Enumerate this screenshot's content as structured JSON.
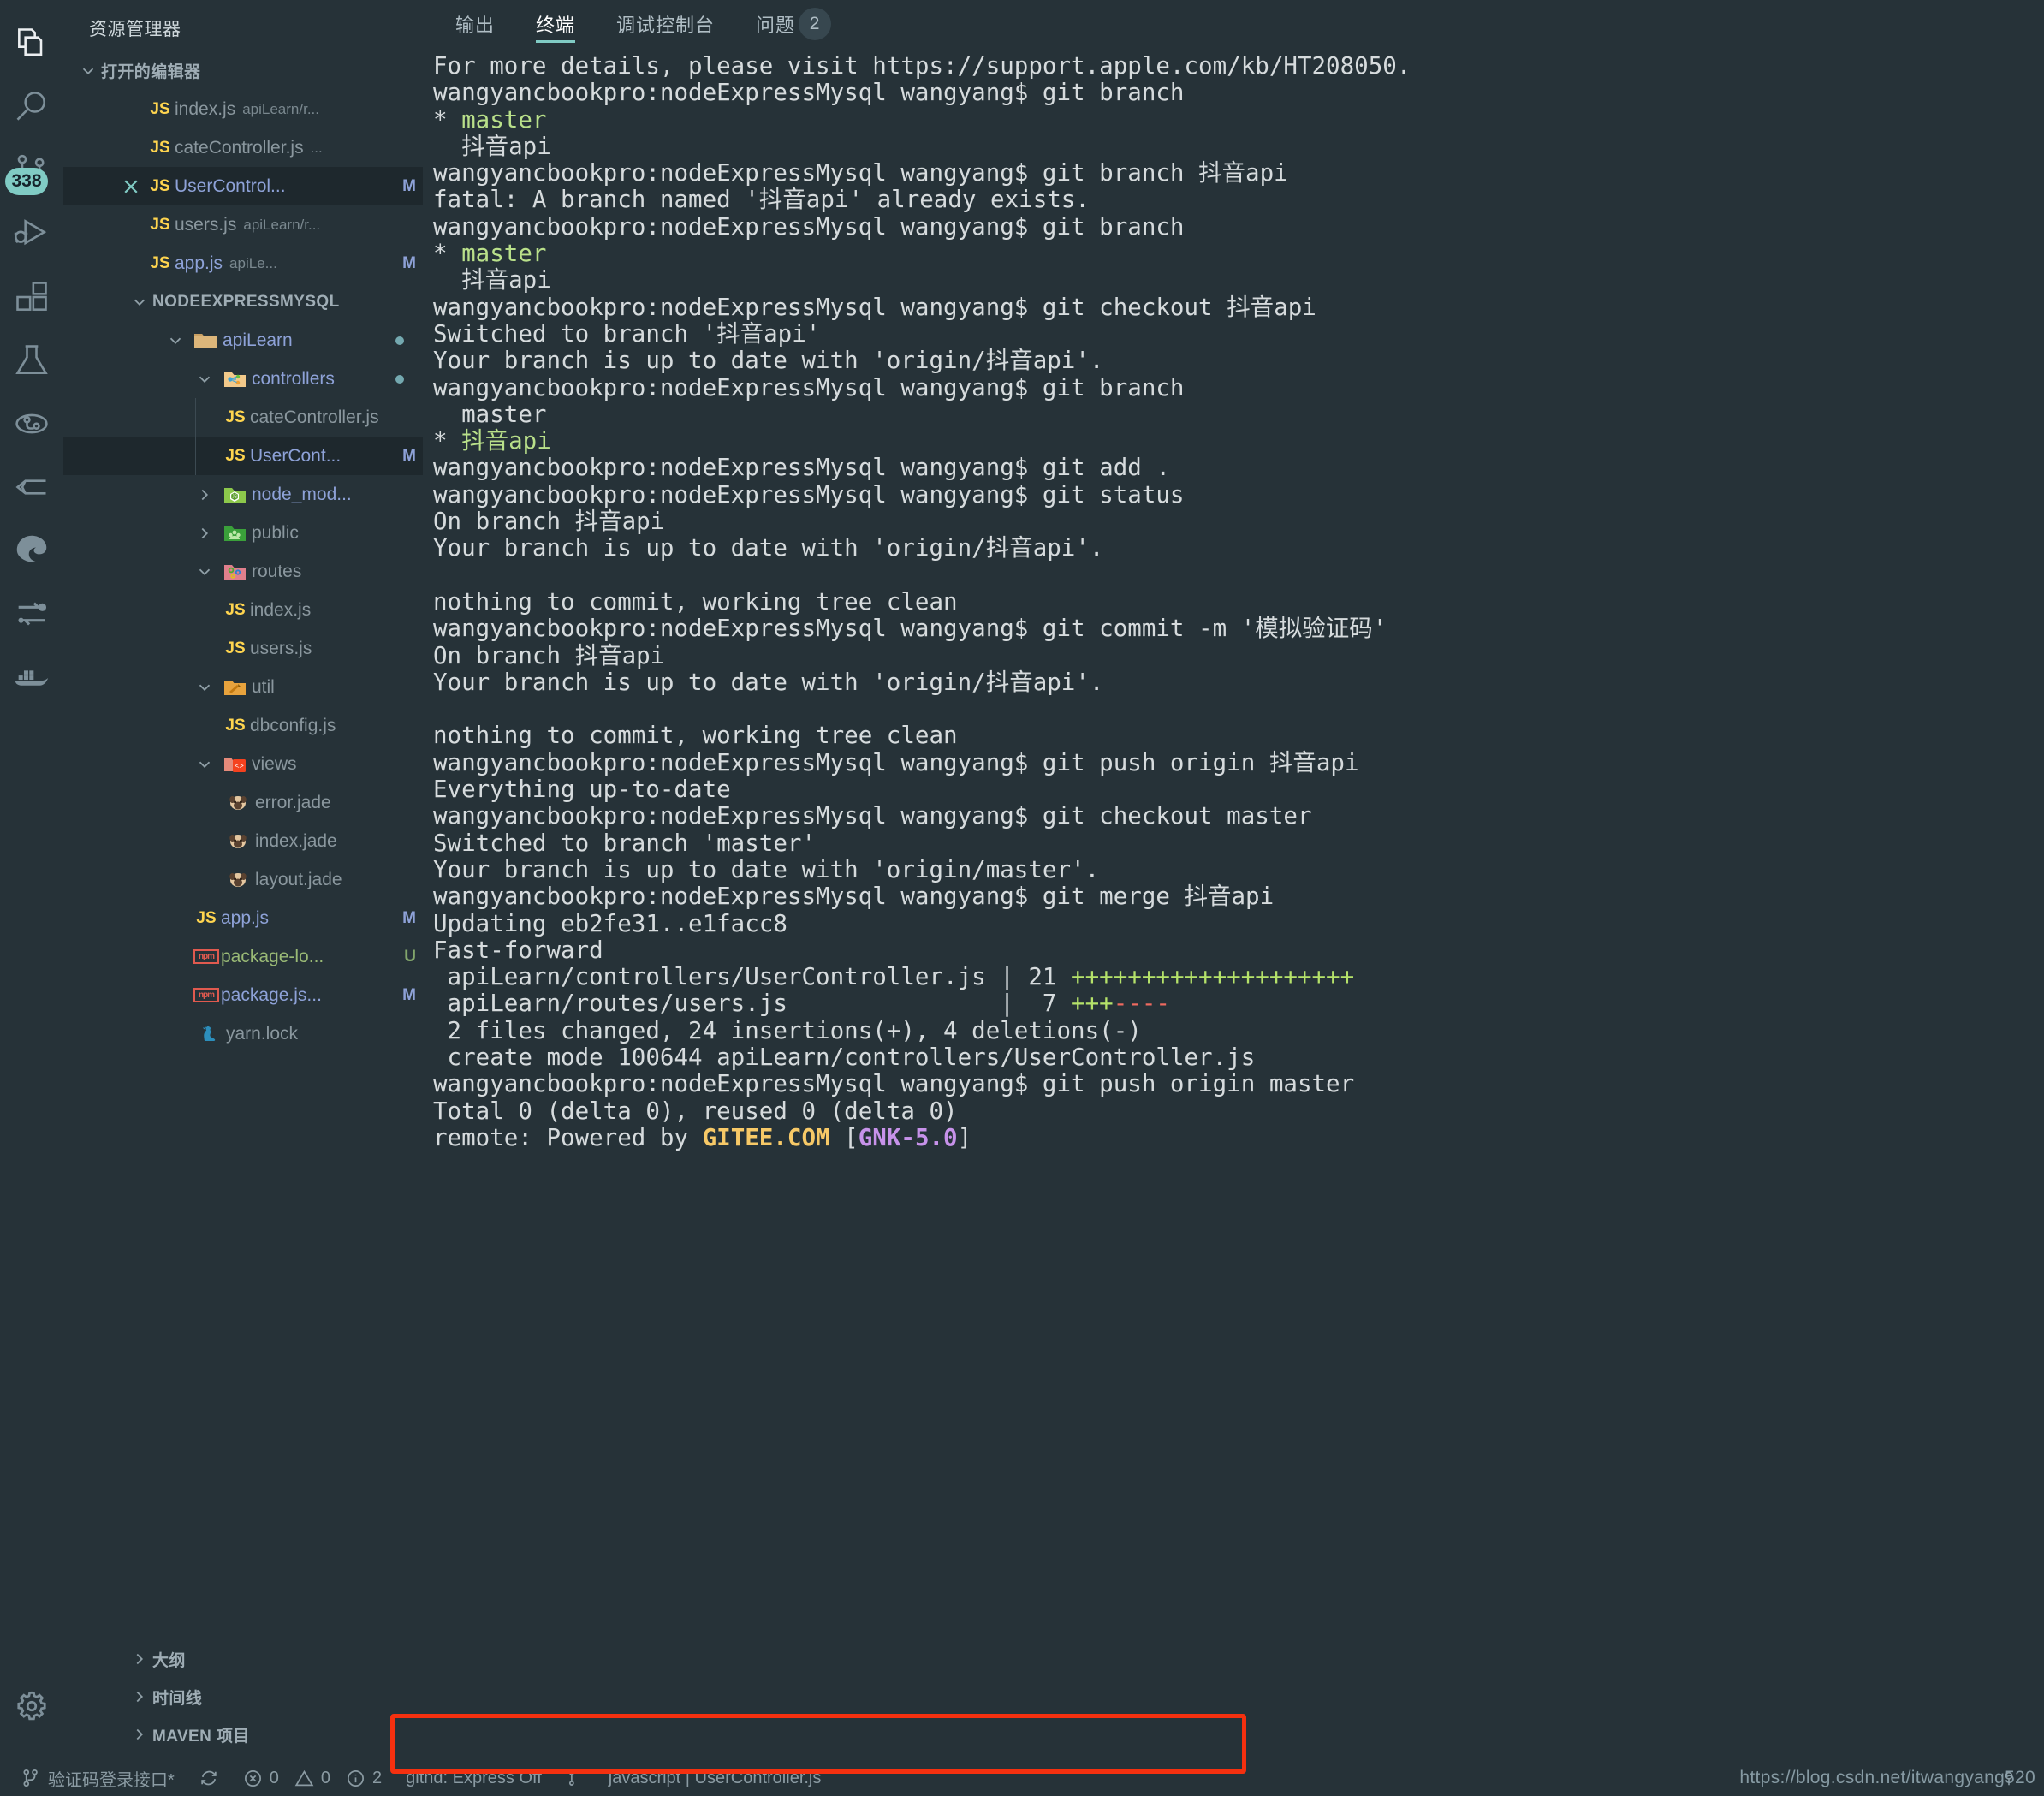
{
  "activity_bar": {
    "items": [
      {
        "name": "explorer-icon",
        "label": "资源管理器",
        "active": true
      },
      {
        "name": "search-icon",
        "label": "搜索",
        "active": false
      },
      {
        "name": "source-control-icon",
        "label": "源代码管理",
        "active": false,
        "badge": "338"
      },
      {
        "name": "run-debug-icon",
        "label": "运行和调试",
        "active": false
      },
      {
        "name": "extensions-icon",
        "label": "扩展",
        "active": false
      },
      {
        "name": "testing-flask-icon",
        "label": "测试",
        "active": false
      },
      {
        "name": "git-graph-icon",
        "label": "Git Graph",
        "active": false
      },
      {
        "name": "gitlens-icon",
        "label": "GitLens",
        "active": false
      },
      {
        "name": "browser-preview-icon",
        "label": "浏览器预览",
        "active": false
      },
      {
        "name": "diff-icon",
        "label": "Diff",
        "active": false
      },
      {
        "name": "docker-icon",
        "label": "Docker",
        "active": false
      }
    ],
    "settings_label": "管理"
  },
  "sidebar": {
    "title": "资源管理器",
    "open_editors": {
      "label": "打开的编辑器",
      "items": [
        {
          "icon": "js-file-icon",
          "name": "index.js",
          "desc": "apiLearn/r...",
          "badge": "",
          "selected": false,
          "close": false
        },
        {
          "icon": "js-file-icon",
          "name": "cateController.js",
          "desc": "...",
          "badge": "",
          "selected": false,
          "close": false
        },
        {
          "icon": "js-file-icon",
          "name": "UserControl...",
          "desc": "",
          "badge": "M",
          "selected": true,
          "close": true
        },
        {
          "icon": "js-file-icon",
          "name": "users.js",
          "desc": "apiLearn/r...",
          "badge": "",
          "selected": false,
          "close": false
        },
        {
          "icon": "js-file-icon",
          "name": "app.js",
          "desc": "apiLe...",
          "badge": "M",
          "selected": false,
          "close": false
        }
      ]
    },
    "project": {
      "label": "NODEEXPRESSMYSQL",
      "tree": [
        {
          "depth": 1,
          "kind": "folder",
          "icon": "folder-plain-icon",
          "name": "apiLearn",
          "expanded": true,
          "dot": true
        },
        {
          "depth": 2,
          "kind": "folder",
          "icon": "folder-controllers-icon",
          "name": "controllers",
          "expanded": true,
          "dot": true
        },
        {
          "depth": 3,
          "kind": "js",
          "icon": "js-file-icon",
          "name": "cateController.js"
        },
        {
          "depth": 3,
          "kind": "js",
          "icon": "js-file-icon",
          "name": "UserCont...",
          "badge": "M",
          "selected": true
        },
        {
          "depth": 2,
          "kind": "folder",
          "icon": "folder-node-icon",
          "name": "node_mod...",
          "expanded": false
        },
        {
          "depth": 2,
          "kind": "folder",
          "icon": "folder-public-icon",
          "name": "public",
          "expanded": false
        },
        {
          "depth": 2,
          "kind": "folder",
          "icon": "folder-routes-icon",
          "name": "routes",
          "expanded": true
        },
        {
          "depth": 3,
          "kind": "js",
          "icon": "js-file-icon",
          "name": "index.js"
        },
        {
          "depth": 3,
          "kind": "js",
          "icon": "js-file-icon",
          "name": "users.js"
        },
        {
          "depth": 2,
          "kind": "folder",
          "icon": "folder-util-icon",
          "name": "util",
          "expanded": true
        },
        {
          "depth": 3,
          "kind": "js",
          "icon": "js-file-icon",
          "name": "dbconfig.js"
        },
        {
          "depth": 2,
          "kind": "folder",
          "icon": "folder-views-icon",
          "name": "views",
          "expanded": true
        },
        {
          "depth": 3,
          "kind": "jade",
          "icon": "pug-file-icon",
          "name": "error.jade"
        },
        {
          "depth": 3,
          "kind": "jade",
          "icon": "pug-file-icon",
          "name": "index.jade"
        },
        {
          "depth": 3,
          "kind": "jade",
          "icon": "pug-file-icon",
          "name": "layout.jade"
        },
        {
          "depth": 2,
          "kind": "js",
          "icon": "js-file-icon",
          "name": "app.js",
          "badge": "M"
        },
        {
          "depth": 2,
          "kind": "npm",
          "icon": "npm-file-icon",
          "name": "package-lo...",
          "badge": "U"
        },
        {
          "depth": 2,
          "kind": "npm",
          "icon": "npm-file-icon",
          "name": "package.js...",
          "badge": "M"
        },
        {
          "depth": 2,
          "kind": "yarn",
          "icon": "yarn-file-icon",
          "name": "yarn.lock"
        }
      ]
    },
    "bottom_sections": [
      {
        "label": "大纲"
      },
      {
        "label": "时间线"
      },
      {
        "label": "MAVEN 项目"
      }
    ]
  },
  "panel": {
    "tabs": [
      {
        "label": "输出",
        "active": false,
        "badge": ""
      },
      {
        "label": "终端",
        "active": true,
        "badge": ""
      },
      {
        "label": "调试控制台",
        "active": false,
        "badge": ""
      },
      {
        "label": "问题",
        "active": false,
        "badge": "2"
      }
    ],
    "terminal_lines": [
      [
        {
          "t": "For more details, please visit https://support.apple.com/kb/HT208050."
        }
      ],
      [
        {
          "t": "wangyancbookpro:nodeExpressMysql wangyang$ git branch"
        }
      ],
      [
        {
          "t": "* "
        },
        {
          "t": "master",
          "c": "g"
        }
      ],
      [
        {
          "t": "  抖音api"
        }
      ],
      [
        {
          "t": "wangyancbookpro:nodeExpressMysql wangyang$ git branch 抖音api"
        }
      ],
      [
        {
          "t": "fatal: A branch named '抖音api' already exists."
        }
      ],
      [
        {
          "t": "wangyancbookpro:nodeExpressMysql wangyang$ git branch"
        }
      ],
      [
        {
          "t": "* "
        },
        {
          "t": "master",
          "c": "g"
        }
      ],
      [
        {
          "t": "  抖音api"
        }
      ],
      [
        {
          "t": "wangyancbookpro:nodeExpressMysql wangyang$ git checkout 抖音api"
        }
      ],
      [
        {
          "t": "Switched to branch '抖音api'"
        }
      ],
      [
        {
          "t": "Your branch is up to date with 'origin/抖音api'."
        }
      ],
      [
        {
          "t": "wangyancbookpro:nodeExpressMysql wangyang$ git branch"
        }
      ],
      [
        {
          "t": "  master"
        }
      ],
      [
        {
          "t": "* "
        },
        {
          "t": "抖音api",
          "c": "g"
        }
      ],
      [
        {
          "t": "wangyancbookpro:nodeExpressMysql wangyang$ git add ."
        }
      ],
      [
        {
          "t": "wangyancbookpro:nodeExpressMysql wangyang$ git status"
        }
      ],
      [
        {
          "t": "On branch 抖音api"
        }
      ],
      [
        {
          "t": "Your branch is up to date with 'origin/抖音api'."
        }
      ],
      [
        {
          "t": ""
        }
      ],
      [
        {
          "t": "nothing to commit, working tree clean"
        }
      ],
      [
        {
          "t": "wangyancbookpro:nodeExpressMysql wangyang$ git commit -m '模拟验证码'"
        }
      ],
      [
        {
          "t": "On branch 抖音api"
        }
      ],
      [
        {
          "t": "Your branch is up to date with 'origin/抖音api'."
        }
      ],
      [
        {
          "t": ""
        }
      ],
      [
        {
          "t": "nothing to commit, working tree clean"
        }
      ],
      [
        {
          "t": "wangyancbookpro:nodeExpressMysql wangyang$ git push origin 抖音api"
        }
      ],
      [
        {
          "t": "Everything up-to-date"
        }
      ],
      [
        {
          "t": "wangyancbookpro:nodeExpressMysql wangyang$ git checkout master"
        }
      ],
      [
        {
          "t": "Switched to branch 'master'"
        }
      ],
      [
        {
          "t": "Your branch is up to date with 'origin/master'."
        }
      ],
      [
        {
          "t": "wangyancbookpro:nodeExpressMysql wangyang$ git merge 抖音api"
        }
      ],
      [
        {
          "t": "Updating eb2fe31..e1facc8"
        }
      ],
      [
        {
          "t": "Fast-forward"
        }
      ],
      [
        {
          "t": " apiLearn/controllers/UserController.js | 21 "
        },
        {
          "t": "++++++++++++++++++++",
          "c": "plus"
        }
      ],
      [
        {
          "t": " apiLearn/routes/users.js               |  7 "
        },
        {
          "t": "+++",
          "c": "plus"
        },
        {
          "t": "----",
          "c": "minus"
        }
      ],
      [
        {
          "t": " 2 files changed, 24 insertions(+), 4 deletions(-)"
        }
      ],
      [
        {
          "t": " create mode 100644 apiLearn/controllers/UserController.js"
        }
      ],
      [
        {
          "t": "wangyancbookpro:nodeExpressMysql wangyang$ git push origin master"
        }
      ],
      [
        {
          "t": "Total 0 (delta 0), reused 0 (delta 0)"
        }
      ],
      [
        {
          "t": "remote: Powered by "
        },
        {
          "t": "GITEE.COM",
          "c": "gitee"
        },
        {
          "t": " ["
        },
        {
          "t": "GNK-5.0",
          "c": "gnk"
        },
        {
          "t": "]"
        }
      ]
    ]
  },
  "status_bar": {
    "branch": "验证码登录接口*",
    "sync_label": "",
    "errors": "0",
    "warnings": "0",
    "infos": "2",
    "githd": "githd: Express Off",
    "git_lens": "",
    "language": "javascript | UserController.js",
    "watermark": "https://blog.csdn.net/itwangyang520"
  },
  "colors": {
    "background": "#263238",
    "accent": "#80cbc4",
    "badge": "#80cbc4",
    "terminal_text": "#d6dbdd",
    "branch_green": "#b9e08a",
    "diff_plus": "#b5e26a",
    "diff_minus": "#ef6a60",
    "gitee_orange": "#f7c967",
    "gnk_purple": "#c792ea",
    "highlight_box": "#f5300f"
  }
}
